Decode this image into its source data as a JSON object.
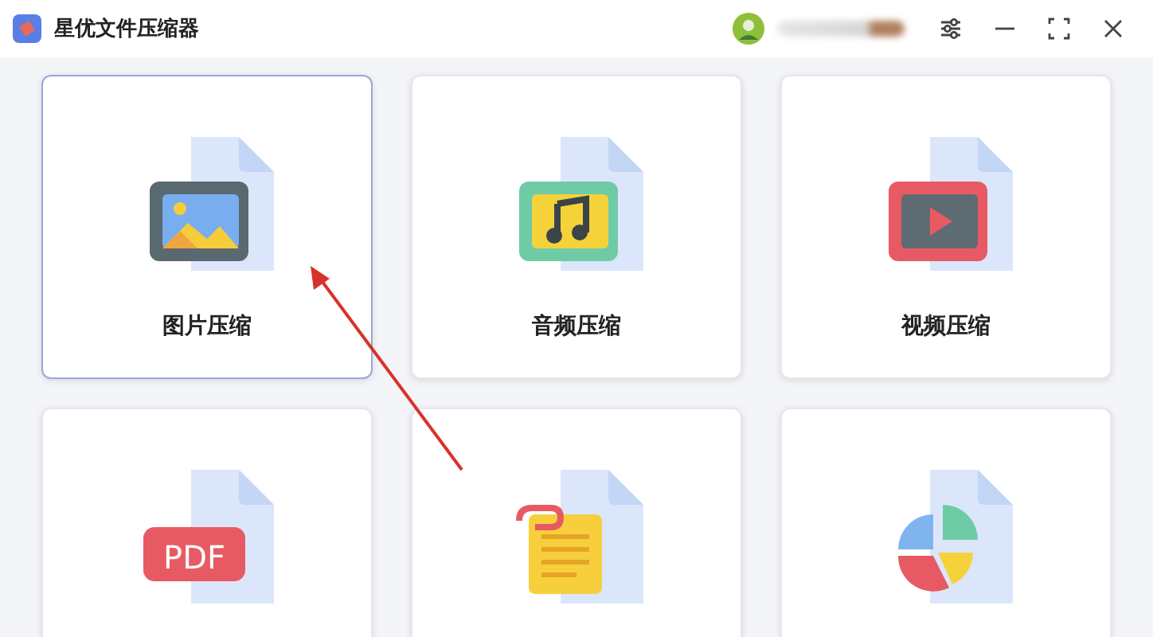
{
  "window": {
    "title": "星优文件压缩器"
  },
  "cards": [
    {
      "kind": "image",
      "label": "图片压缩",
      "selected": true
    },
    {
      "kind": "audio",
      "label": "音频压缩",
      "selected": false
    },
    {
      "kind": "video",
      "label": "视频压缩",
      "selected": false
    },
    {
      "kind": "pdf",
      "pdf_text": "PDF",
      "selected": false
    },
    {
      "kind": "document",
      "selected": false
    },
    {
      "kind": "chart",
      "selected": false
    }
  ]
}
